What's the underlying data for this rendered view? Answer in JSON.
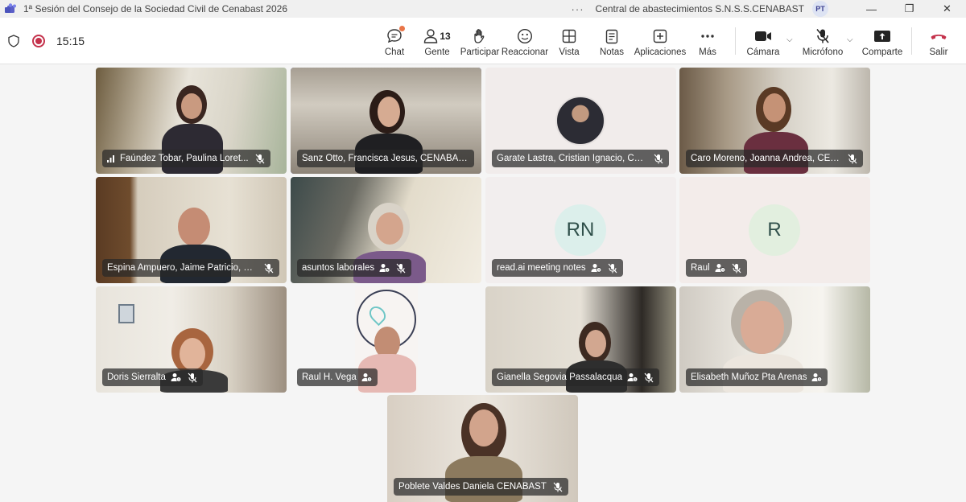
{
  "window": {
    "title": "1ª Sesión del Consejo de la Sociedad Civil de Cenabast 2026",
    "more": "···",
    "org": "Central de abastecimientos S.N.S.S.CENABAST",
    "user_initials": "PT",
    "minimize": "—",
    "restore": "❐",
    "close": "✕"
  },
  "meeting": {
    "timer": "15:15"
  },
  "toolbar": {
    "chat_label": "Chat",
    "people_label": "Gente",
    "people_count": "13",
    "raise_label": "Participar",
    "react_label": "Reaccionar",
    "view_label": "Vista",
    "notes_label": "Notas",
    "apps_label": "Aplicaciones",
    "more_label": "Más",
    "camera_label": "Cámara",
    "mic_label": "Micrófono",
    "share_label": "Comparte",
    "leave_label": "Salir"
  },
  "participants": [
    {
      "name": "Faúndez Tobar, Paulina Loret..."
    },
    {
      "name": "Sanz Otto, Francisca Jesus, CENABAST"
    },
    {
      "name": "Garate Lastra, Cristian Ignacio, CE..."
    },
    {
      "name": "Caro Moreno, Joanna Andrea, CEN..."
    },
    {
      "name": "Espina Ampuero, Jaime Patricio, C..."
    },
    {
      "name": "asuntos laborales"
    },
    {
      "name": "read.ai meeting notes",
      "initials": "RN"
    },
    {
      "name": "Raul",
      "initials": "R"
    },
    {
      "name": "Doris Sierralta"
    },
    {
      "name": "Raul H. Vega"
    },
    {
      "name": "Gianella Segovia Passalacqua"
    },
    {
      "name": "Elisabeth Muñoz Pta Arenas"
    },
    {
      "name": "Poblete Valdes Daniela CENABAST"
    }
  ],
  "colors": {
    "accent": "#5b5fc7",
    "leave": "#c4314b",
    "chat_dot": "#e97548"
  }
}
